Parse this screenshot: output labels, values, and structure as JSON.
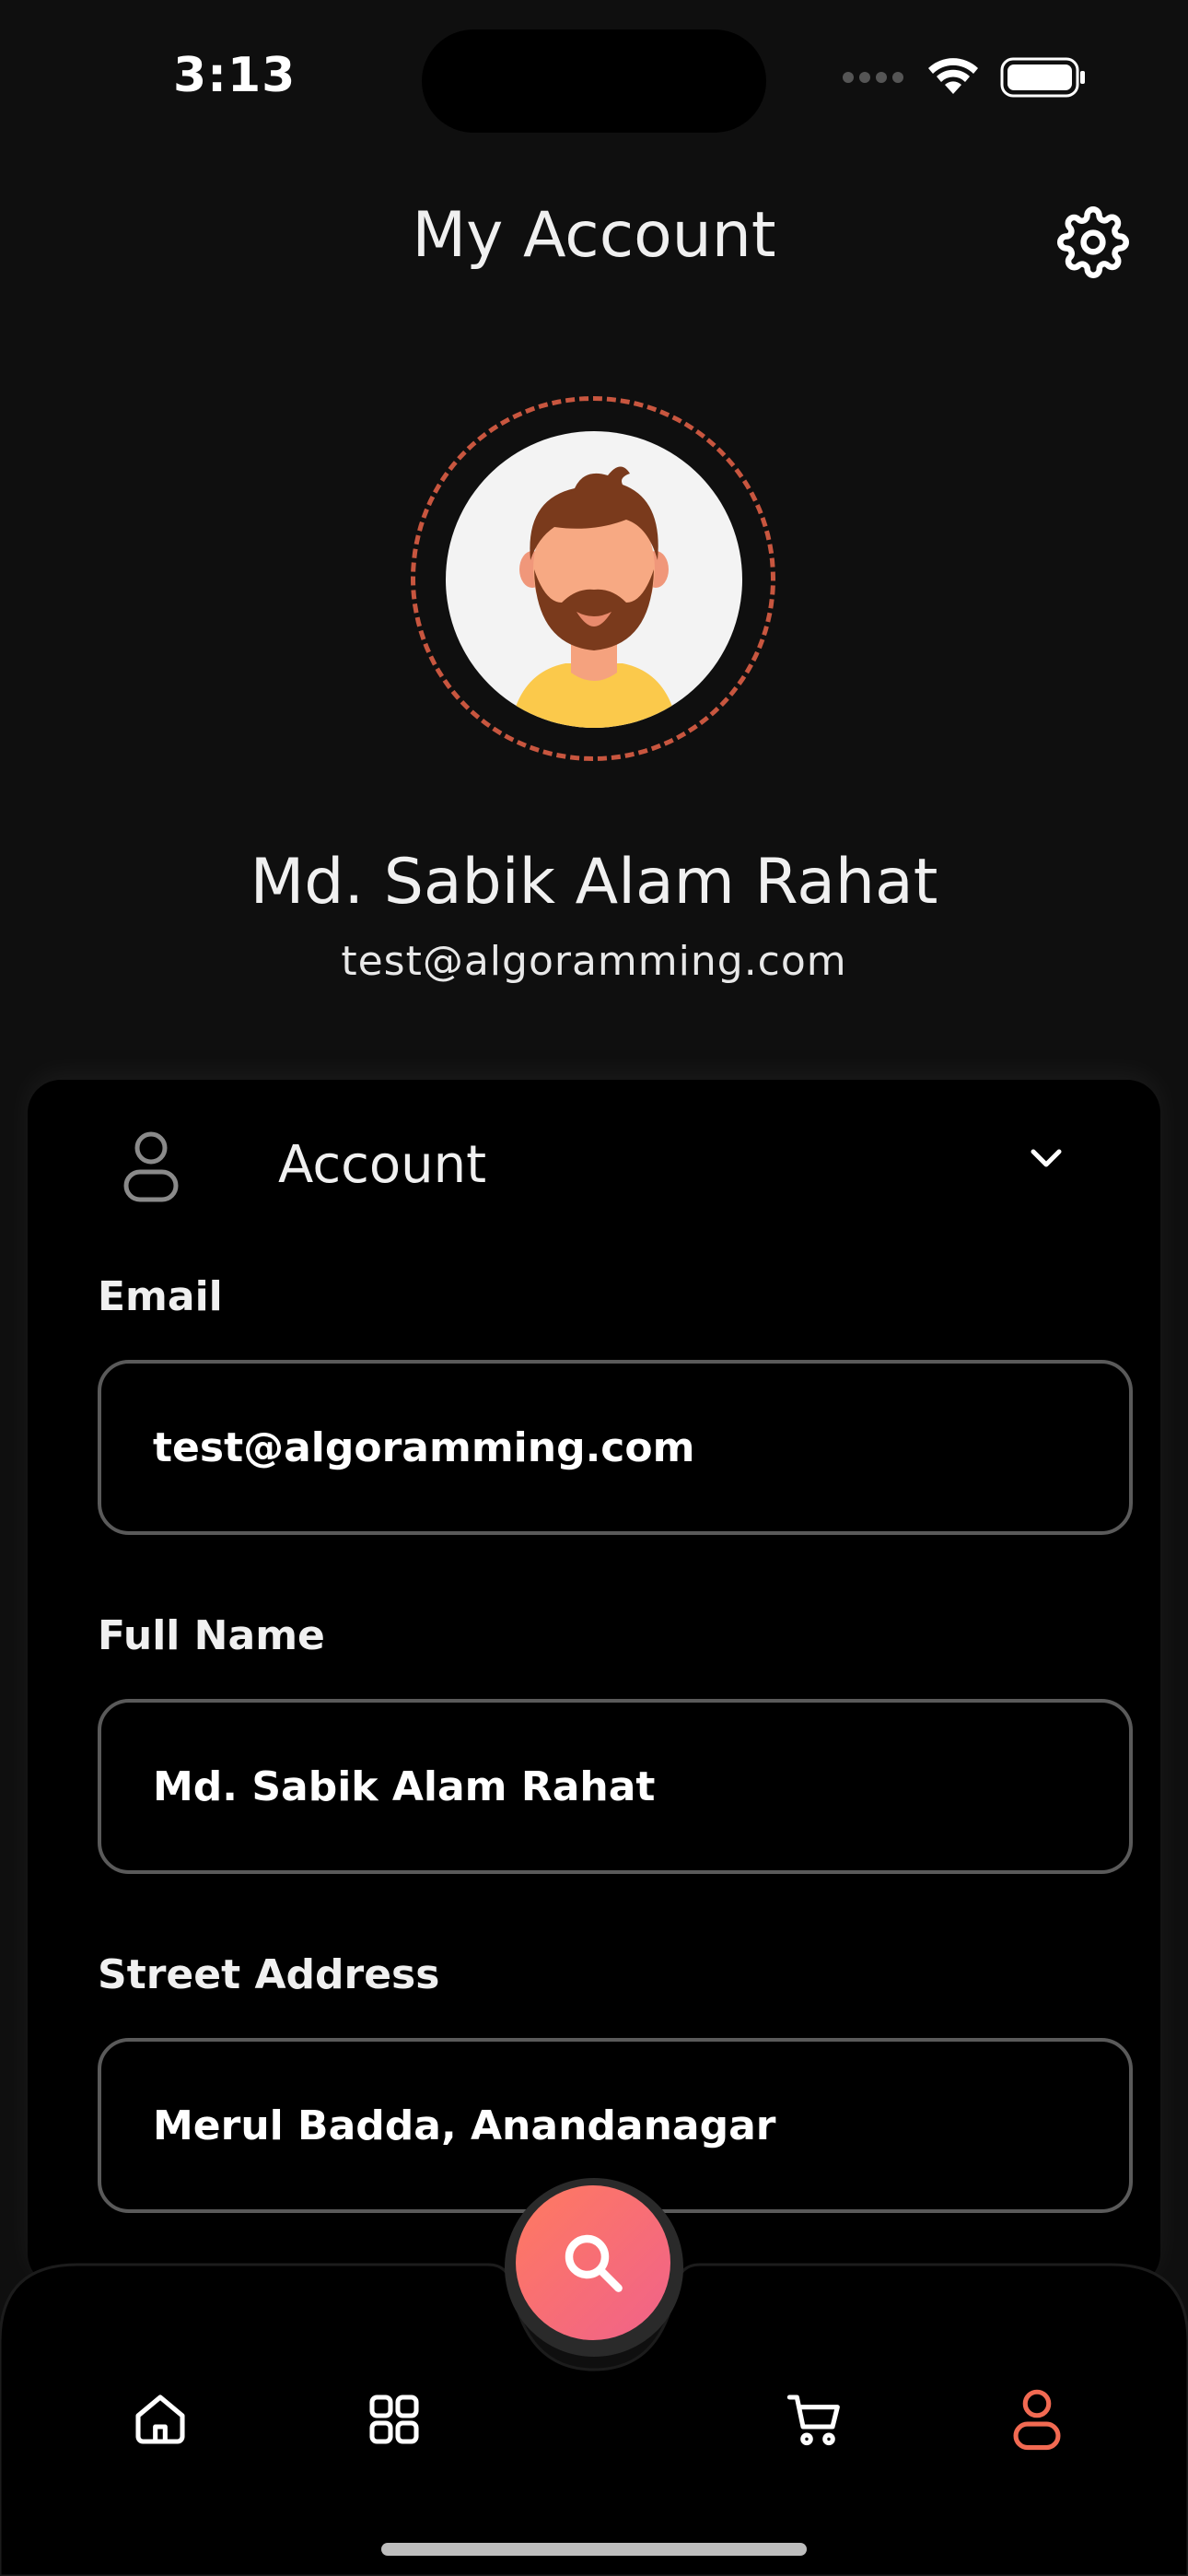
{
  "status_bar": {
    "time": "3:13",
    "icons": [
      "signal-dots-icon",
      "wifi-icon",
      "battery-icon"
    ]
  },
  "header": {
    "title": "My Account",
    "settings_icon": "gear-icon"
  },
  "profile": {
    "name": "Md. Sabik Alam Rahat",
    "email": "test@algoramming.com",
    "ring_color": "#c8563f"
  },
  "account_section": {
    "title": "Account",
    "icon": "user-icon",
    "expand_icon": "chevron-down-icon",
    "fields": [
      {
        "label": "Email",
        "value": "test@algoramming.com"
      },
      {
        "label": "Full Name",
        "value": "Md. Sabik Alam Rahat"
      },
      {
        "label": "Street Address",
        "value": "Merul Badda, Anandanagar"
      }
    ]
  },
  "bottom_nav": {
    "items": [
      "home-icon",
      "grid-icon",
      "cart-icon",
      "user-icon"
    ],
    "active": "user-icon",
    "fab_icon": "search-icon",
    "accent": "#f26a52",
    "fab_gradient": [
      "#ff7a60",
      "#f0628a"
    ]
  }
}
